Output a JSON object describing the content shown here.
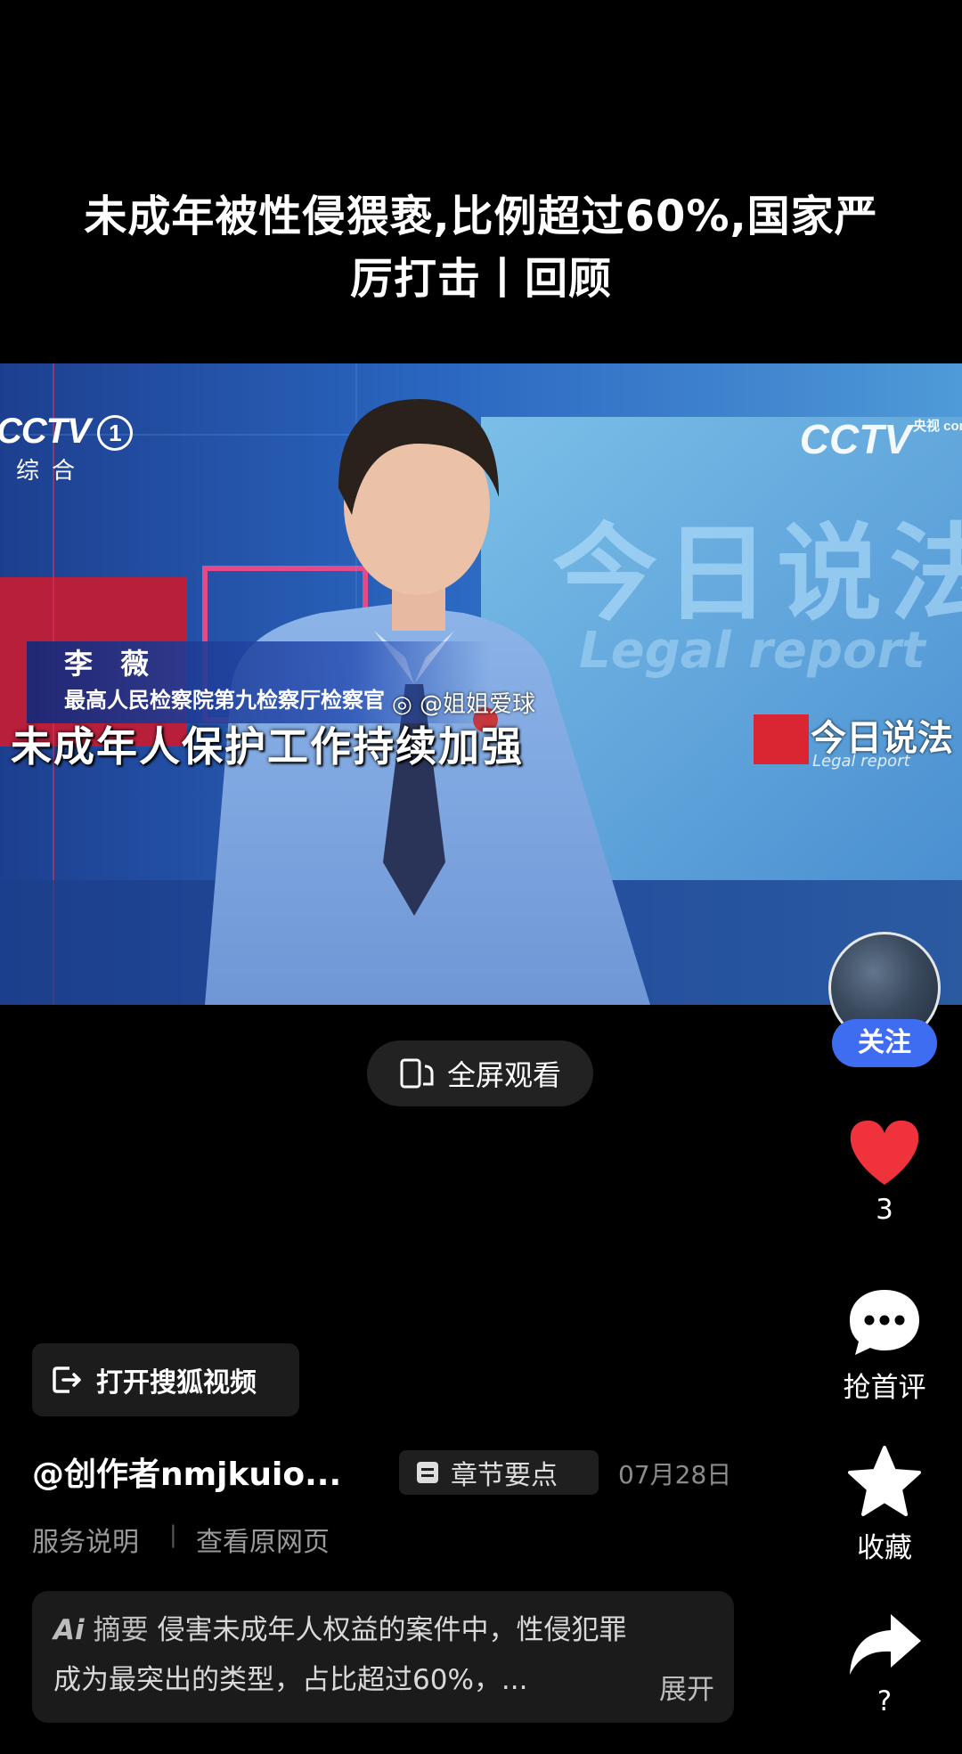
{
  "post": {
    "title_line1": "未成年被性侵猥亵,比例超过60%,国家严",
    "title_line2": "厉打击丨回顾"
  },
  "video": {
    "channel_logo": "CCTV",
    "channel_number": "1",
    "channel_sub": "综合",
    "corner_watermark": "CCTV",
    "corner_watermark_small": "央视 com",
    "background_text": "今日说法",
    "background_text_en": "Legal report",
    "speaker_name": "李 薇",
    "speaker_title": "最高人民检察院第九检察厅检察官",
    "subtitle": "未成年人保护工作持续加强",
    "weibo_watermark": "@姐姐爱球",
    "show_logo": "今日说法",
    "show_logo_sub": "Legal report"
  },
  "fullscreen": {
    "label": "全屏观看"
  },
  "actions": {
    "follow_label": "关注",
    "like_count": "3",
    "comment_label": "抢首评",
    "favorite_label": "收藏",
    "share_label": "?"
  },
  "bottom": {
    "open_app_label": "打开搜狐视频",
    "author": "@创作者nmjkuio...",
    "chapter_label": "章节要点",
    "date": "07月28日",
    "service_link": "服务说明",
    "separator": "|",
    "original_link": "查看原网页"
  },
  "ai_summary": {
    "badge": "Ai",
    "label": "摘要",
    "line1": "侵害未成年人权益的案件中，性侵犯罪",
    "line2": "成为最突出的类型，占比超过60%，...",
    "expand": "展开"
  },
  "colors": {
    "background": "#000000",
    "follow_blue": "#3f6df2",
    "like_red": "#f0323c"
  },
  "icons": [
    "fullscreen-rotate-icon",
    "heart-icon",
    "comment-bubble-icon",
    "star-icon",
    "share-arrow-icon",
    "exit-app-icon",
    "chapter-list-icon"
  ]
}
